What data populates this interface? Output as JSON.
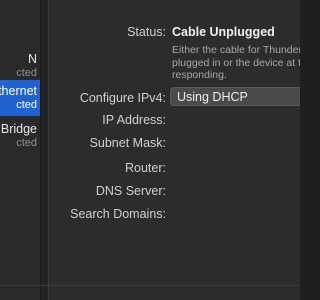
{
  "sidebar": {
    "items": [
      {
        "name": "N",
        "status": "cted",
        "selected": false
      },
      {
        "name": "thernet",
        "status": "cted",
        "selected": true
      },
      {
        "name": "Bridge",
        "status": "cted",
        "selected": false
      }
    ]
  },
  "detail": {
    "status_label": "Status:",
    "status_value": "Cable Unplugged",
    "status_description": [
      "Either the cable for Thunderbol",
      "plugged in or the device at the",
      "responding."
    ],
    "configure_ipv4_label": "Configure IPv4:",
    "configure_ipv4_value": "Using DHCP",
    "ip_address_label": "IP Address:",
    "subnet_mask_label": "Subnet Mask:",
    "router_label": "Router:",
    "dns_server_label": "DNS Server:",
    "search_domains_label": "Search Domains:"
  },
  "colors": {
    "selection": "#1f63d0",
    "panel_bg": "#2c2c2c",
    "sidebar_bg": "#2a2a2a"
  }
}
